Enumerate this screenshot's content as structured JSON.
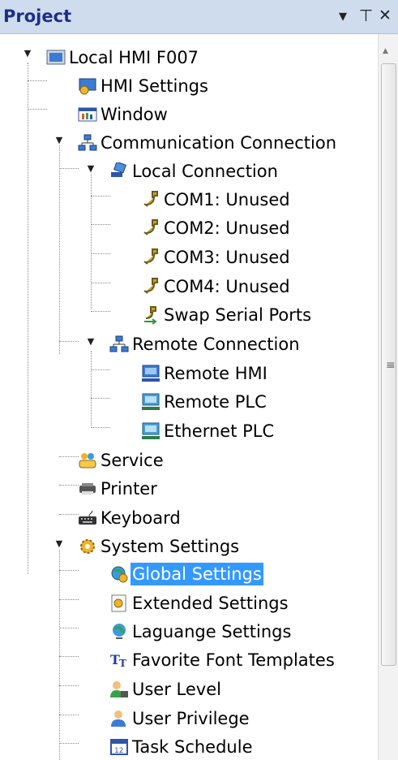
{
  "panel": {
    "title": "Project",
    "controls": {
      "dropdown": "▾",
      "pin": "⊣",
      "close": "✕"
    }
  },
  "tree": {
    "items": [
      {
        "label": "Local HMI F007",
        "icon": "hmi-device-icon",
        "expanded": true
      },
      {
        "label": "HMI Settings",
        "icon": "hmi-settings-icon"
      },
      {
        "label": "Window",
        "icon": "window-icon"
      },
      {
        "label": "Communication Connection",
        "icon": "network-icon",
        "expanded": true
      },
      {
        "label": "Local Connection",
        "icon": "local-connection-icon",
        "expanded": true
      },
      {
        "label": "COM1: Unused",
        "icon": "serial-port-icon"
      },
      {
        "label": "COM2: Unused",
        "icon": "serial-port-icon"
      },
      {
        "label": "COM3: Unused",
        "icon": "serial-port-icon"
      },
      {
        "label": "COM4: Unused",
        "icon": "serial-port-icon"
      },
      {
        "label": "Swap Serial Ports",
        "icon": "swap-ports-icon"
      },
      {
        "label": "Remote Connection",
        "icon": "network-icon",
        "expanded": true
      },
      {
        "label": "Remote HMI",
        "icon": "remote-hmi-icon"
      },
      {
        "label": "Remote PLC",
        "icon": "remote-plc-icon"
      },
      {
        "label": "Ethernet PLC",
        "icon": "ethernet-plc-icon"
      },
      {
        "label": "Service",
        "icon": "service-icon"
      },
      {
        "label": "Printer",
        "icon": "printer-icon"
      },
      {
        "label": "Keyboard",
        "icon": "keyboard-icon"
      },
      {
        "label": "System Settings",
        "icon": "system-settings-icon",
        "expanded": true
      },
      {
        "label": "Global Settings",
        "icon": "global-settings-icon",
        "selected": true
      },
      {
        "label": "Extended Settings",
        "icon": "extended-settings-icon"
      },
      {
        "label": "Laguange Settings",
        "icon": "language-icon"
      },
      {
        "label": "Favorite Font Templates",
        "icon": "font-templates-icon"
      },
      {
        "label": "User Level",
        "icon": "user-level-icon"
      },
      {
        "label": "User Privilege",
        "icon": "user-privilege-icon"
      },
      {
        "label": "Task Schedule",
        "icon": "task-schedule-icon"
      }
    ]
  },
  "colors": {
    "header_bg": "#cfdcee",
    "title": "#1b2f86",
    "selection": "#3399ff"
  }
}
